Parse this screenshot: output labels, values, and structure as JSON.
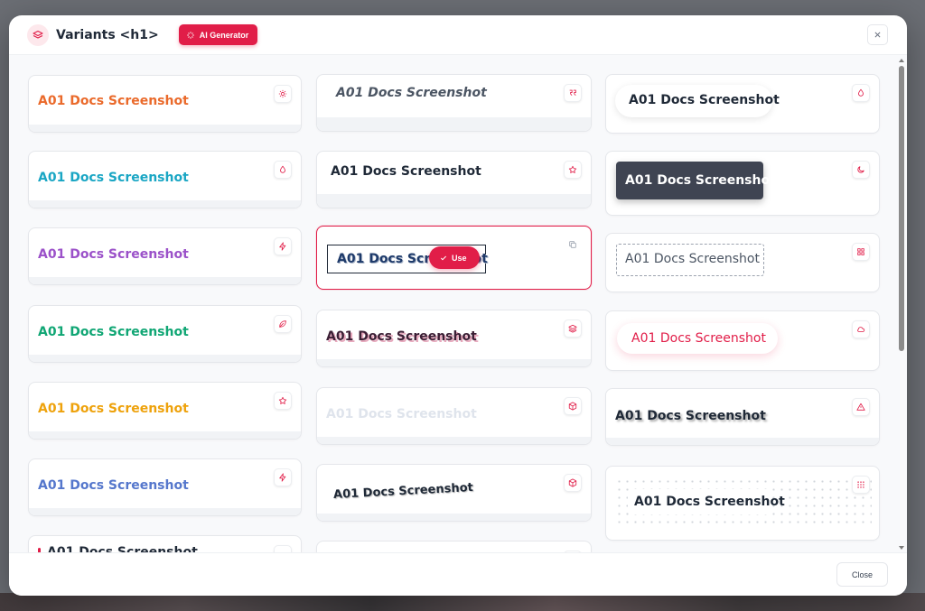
{
  "header": {
    "title": "Variants <h1>",
    "ai_button_label": "AI Generator",
    "icon": "layers-icon",
    "close_icon": "close-icon"
  },
  "sample_text": "A01 Docs Screenshot",
  "cards": {
    "c1": {
      "icon": "sun-icon",
      "color": "#ea6a2b"
    },
    "c2": {
      "icon": "droplet-icon",
      "color": "#1aa6c4"
    },
    "c3": {
      "icon": "bolt-icon",
      "color": "#9b51c9"
    },
    "c4": {
      "icon": "leaf-icon",
      "color": "#10a674"
    },
    "c5": {
      "icon": "star-icon",
      "color": "#eea20c"
    },
    "c6": {
      "icon": "bolt-icon",
      "color": "#5577cc"
    },
    "m1": {
      "icon": "quote-icon",
      "color": "#4b5563"
    },
    "m2": {
      "icon": "star-icon",
      "color": "#1f2937"
    },
    "m3": {
      "icon": "copy-icon",
      "color": "#1e3a6a"
    },
    "m4": {
      "icon": "layers-icon",
      "color": "#3b1f35"
    },
    "m5": {
      "icon": "cube-icon",
      "color": "#dfe4ec"
    },
    "m6": {
      "icon": "cube-icon",
      "color": "#1f2937"
    },
    "r1": {
      "icon": "droplet-icon",
      "color": "#1f2937"
    },
    "r2": {
      "icon": "moon-icon",
      "color": "#ffffff"
    },
    "r3": {
      "icon": "grid-icon",
      "color": "#4b5563"
    },
    "r4": {
      "icon": "cloud-icon",
      "color": "#e11d48"
    },
    "r5": {
      "icon": "warning-icon",
      "color": "#1f2937"
    },
    "r6": {
      "icon": "dots-grid-icon",
      "color": "#1f2937"
    }
  },
  "use_button_label": "Use",
  "footer": {
    "close_label": "Close"
  },
  "colors": {
    "accent": "#e11d48"
  }
}
